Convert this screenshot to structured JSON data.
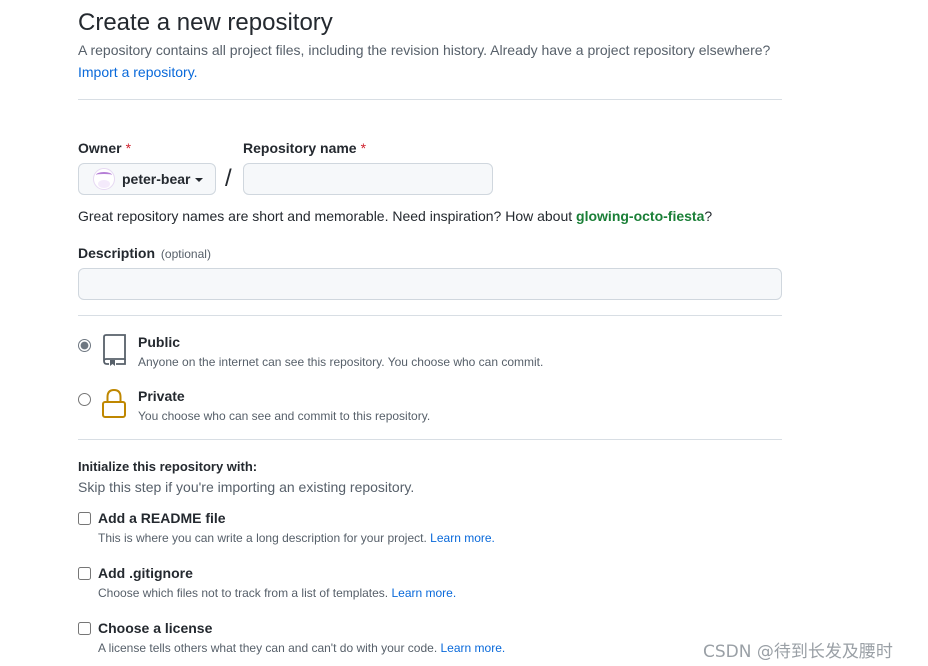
{
  "header": {
    "title": "Create a new repository",
    "subtitle": "A repository contains all project files, including the revision history. Already have a project repository elsewhere?",
    "import_link": "Import a repository",
    "import_suffix": "."
  },
  "owner": {
    "label": "Owner",
    "required_mark": "*",
    "selected": "peter-bear"
  },
  "separator": "/",
  "repo_name": {
    "label": "Repository name",
    "required_mark": "*",
    "value": "",
    "hint_prefix": "Great repository names are short and memorable. Need inspiration? How about ",
    "suggestion": "glowing-octo-fiesta",
    "hint_suffix": "?"
  },
  "description": {
    "label": "Description",
    "optional": "(optional)",
    "value": ""
  },
  "visibility": {
    "options": [
      {
        "title": "Public",
        "desc": "Anyone on the internet can see this repository. You choose who can commit.",
        "icon": "repo-icon",
        "checked": true
      },
      {
        "title": "Private",
        "desc": "You choose who can see and commit to this repository.",
        "icon": "lock-icon",
        "checked": false
      }
    ]
  },
  "init": {
    "title": "Initialize this repository with:",
    "subtitle": "Skip this step if you're importing an existing repository.",
    "options": [
      {
        "title": "Add a README file",
        "desc": "This is where you can write a long description for your project.",
        "link": "Learn more."
      },
      {
        "title": "Add .gitignore",
        "desc": "Choose which files not to track from a list of templates.",
        "link": "Learn more."
      },
      {
        "title": "Choose a license",
        "desc": "A license tells others what they can and can't do with your code.",
        "link": "Learn more."
      }
    ]
  },
  "watermark": "CSDN @待到长发及腰时",
  "colors": {
    "link": "#0969da",
    "suggestion": "#1a7f37",
    "required": "#cf222e",
    "private_icon": "#bf8700"
  }
}
